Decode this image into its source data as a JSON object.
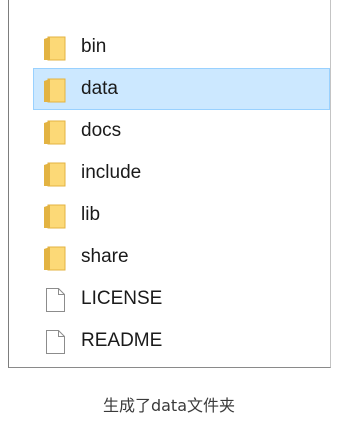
{
  "files": [
    {
      "name": "bin",
      "type": "folder",
      "icon": "folder-icon"
    },
    {
      "name": "data",
      "type": "folder",
      "icon": "folder-icon"
    },
    {
      "name": "docs",
      "type": "folder",
      "icon": "folder-icon"
    },
    {
      "name": "include",
      "type": "folder",
      "icon": "folder-icon"
    },
    {
      "name": "lib",
      "type": "folder",
      "icon": "folder-icon"
    },
    {
      "name": "share",
      "type": "folder",
      "icon": "folder-icon"
    },
    {
      "name": "LICENSE",
      "type": "file",
      "icon": "file-icon"
    },
    {
      "name": "README",
      "type": "file",
      "icon": "file-icon"
    }
  ],
  "selected": "data",
  "caption": "生成了data文件夹",
  "colors": {
    "selection_fill": "#cce8ff",
    "selection_border": "#99d1ff",
    "folder_body": "#fcd977",
    "folder_edge": "#e3b342",
    "file_outline": "#8c8c8c"
  }
}
